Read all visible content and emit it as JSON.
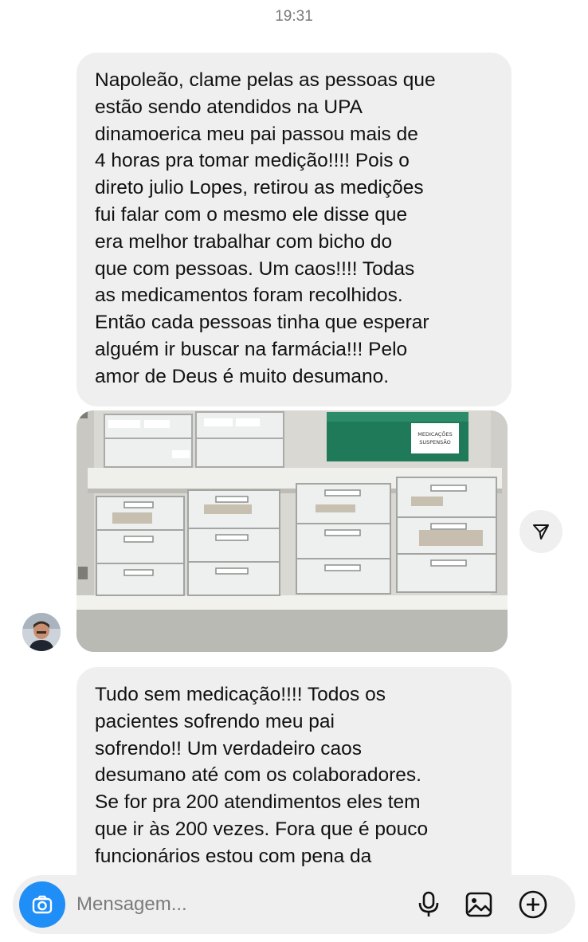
{
  "header": {
    "time": "19:31"
  },
  "messages": [
    {
      "text": "Napoleão, clame pelas as pessoas que\nestão sendo atendidos na UPA\ndinamoerica meu pai passou mais de\n4 horas pra tomar medição!!!! Pois o\ndireto julio Lopes, retirou as medições\nfui falar com o mesmo ele disse que\nera melhor trabalhar com bicho do\nque com pessoas. Um caos!!!! Todas\nas medicamentos foram recolhidos.\nEntão cada pessoas tinha que esperar\nalguém ir buscar na farmácia!!! Pelo\namor de Deus é muito desumano."
    },
    {
      "text": "Tudo sem medicação!!!! Todos os\npacientes sofrendo meu pai\nsofrendo!! Um verdadeiro caos\ndesumano até com os colaboradores.\nSe for pra 200 atendimentos eles tem\nque ir às 200 vezes. Fora que é pouco\nfuncionários estou com pena da"
    }
  ],
  "photo": {
    "box_label_line1": "MEDICAÇÕES",
    "box_label_line2": "SUSPENSÃO"
  },
  "composer": {
    "placeholder": "Mensagem..."
  },
  "icons": {
    "share": "send-icon",
    "camera": "camera-icon",
    "mic": "microphone-icon",
    "gallery": "image-icon",
    "plus": "plus-icon"
  },
  "colors": {
    "accent": "#1f8ff7",
    "bubble": "#efefef",
    "timestamp": "#7a7a7a"
  }
}
